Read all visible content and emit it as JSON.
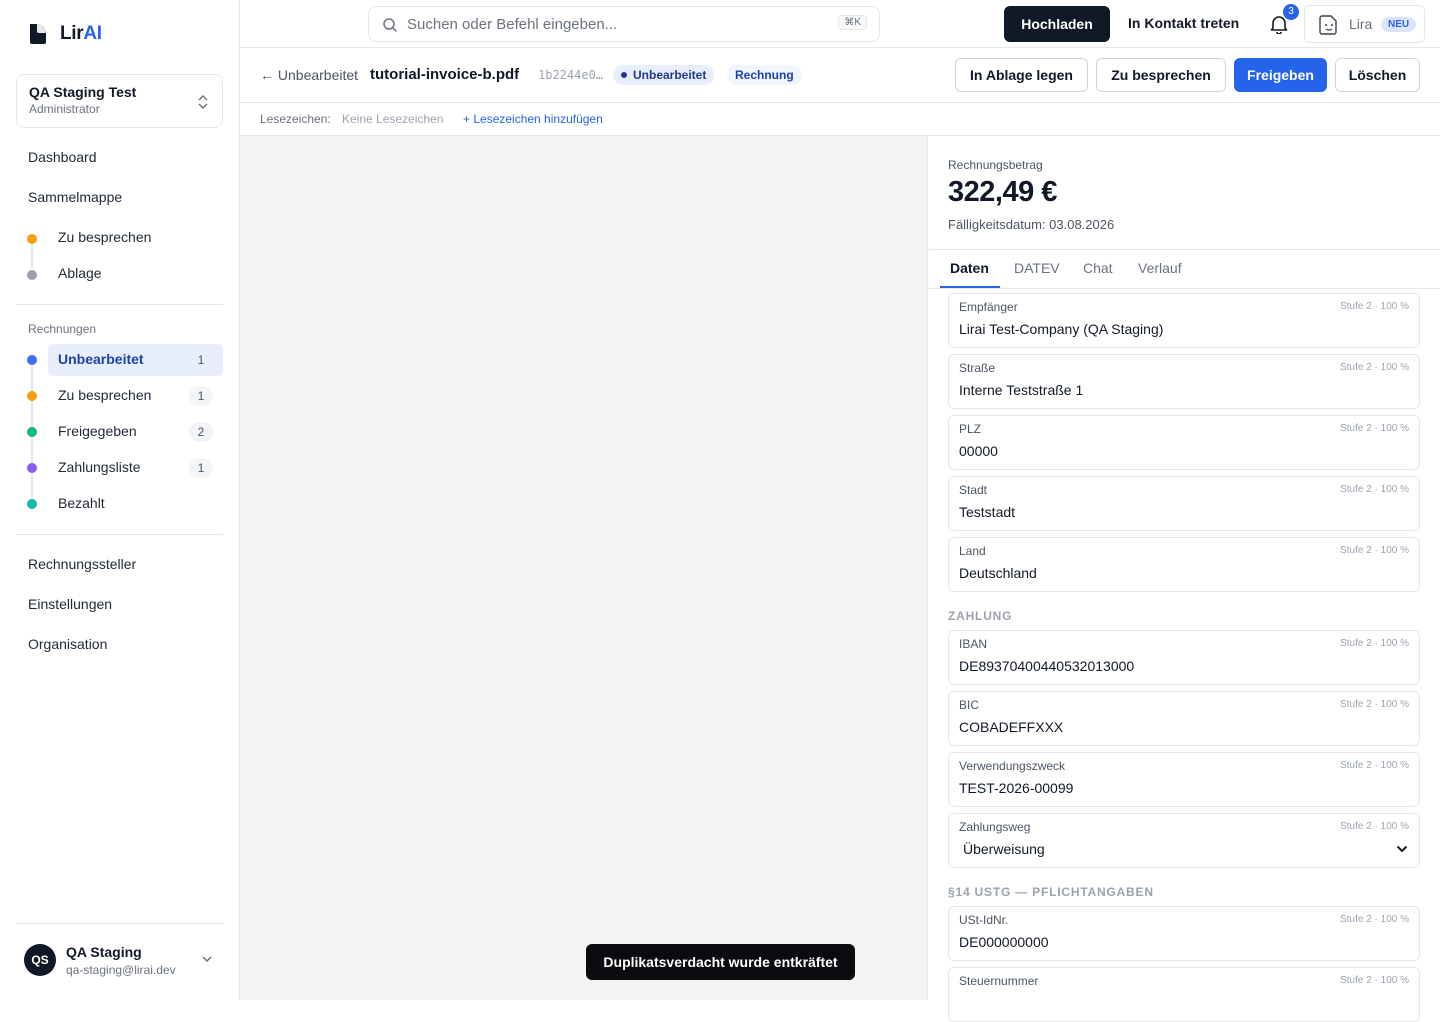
{
  "app": {
    "brand_a": "Lir",
    "brand_b": "AI"
  },
  "org": {
    "name": "QA Staging Test",
    "role": "Administrator"
  },
  "nav": {
    "dashboard": "Dashboard",
    "collection": "Sammelmappe",
    "collection_items": [
      "Zu besprechen",
      "Ablage"
    ],
    "invoices_label": "Rechnungen",
    "invoice_items": [
      {
        "label": "Unbearbeitet",
        "count": "1"
      },
      {
        "label": "Zu besprechen",
        "count": "1"
      },
      {
        "label": "Freigegeben",
        "count": "2"
      },
      {
        "label": "Zahlungsliste",
        "count": "1"
      },
      {
        "label": "Bezahlt",
        "count": ""
      }
    ],
    "bottom": [
      "Rechnungssteller",
      "Einstellungen",
      "Organisation"
    ]
  },
  "user": {
    "initials": "QS",
    "name": "QA Staging",
    "email": "qa-staging@lirai.dev"
  },
  "topbar": {
    "search_placeholder": "Suchen oder Befehl eingeben...",
    "shortcut": "⌘K",
    "upload": "Hochladen",
    "contact": "In Kontakt treten",
    "notifications": "3",
    "assistant": "Lira",
    "assistant_badge": "NEU"
  },
  "document": {
    "back": "← Unbearbeitet",
    "filename": "tutorial-invoice-b.pdf",
    "hash": "1b2244e0…",
    "status": "Unbearbeitet",
    "type": "Rechnung",
    "actions": {
      "archive": "In Ablage legen",
      "discuss": "Zu besprechen",
      "approve": "Freigeben",
      "delete": "Löschen"
    }
  },
  "bookmarks": {
    "label": "Lesezeichen:",
    "none": "Keine Lesezeichen",
    "add": "+ Lesezeichen hinzufügen"
  },
  "toast": "Duplikatsverdacht wurde entkräftet",
  "panel": {
    "amount_label": "Rechnungsbetrag",
    "amount": "322,49 €",
    "due": "Fälligkeitsdatum: 03.08.2026",
    "tabs": [
      "Daten",
      "DATEV",
      "Chat",
      "Verlauf"
    ],
    "confidence": "Stufe 2 · 100 %",
    "fields_address": [
      {
        "label": "Empfänger",
        "value": "Lirai Test-Company (QA Staging)"
      },
      {
        "label": "Straße",
        "value": "Interne Teststraße 1"
      },
      {
        "label": "PLZ",
        "value": "00000"
      },
      {
        "label": "Stadt",
        "value": "Teststadt"
      },
      {
        "label": "Land",
        "value": "Deutschland"
      }
    ],
    "section_payment": "ZAHLUNG",
    "fields_payment": [
      {
        "label": "IBAN",
        "value": "DE89370400440532013000"
      },
      {
        "label": "BIC",
        "value": "COBADEFFXXX"
      },
      {
        "label": "Verwendungszweck",
        "value": "TEST-2026-00099"
      },
      {
        "label": "Zahlungsweg",
        "value": "Überweisung"
      }
    ],
    "section_tax": "§14 USTG — PFLICHTANGABEN",
    "fields_tax": [
      {
        "label": "USt-IdNr.",
        "value": "DE000000000"
      },
      {
        "label": "Steuernummer",
        "value": ""
      }
    ]
  },
  "colors": {
    "accent": "#2563eb",
    "dark": "#111827",
    "orange": "#f59e0b",
    "gray": "#9ca3af",
    "blue": "#3b6ef0",
    "green": "#10b981",
    "purple": "#8b5cf6",
    "teal": "#14b8a6"
  }
}
